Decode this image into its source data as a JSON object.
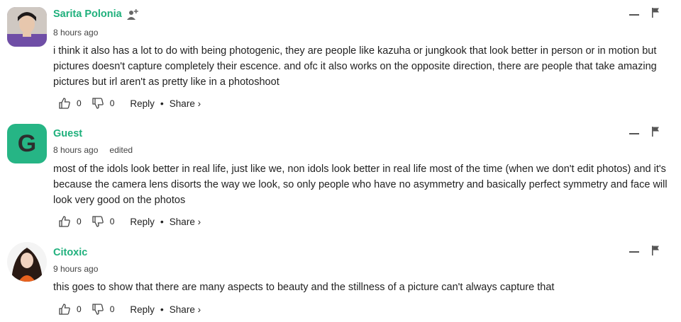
{
  "comments": [
    {
      "author": "Sarita Polonia",
      "time": "8 hours ago",
      "edited": "",
      "text": "i think it also has a lot to do with being photogenic, they are people like kazuha or jungkook that look better in person or in motion but pictures doesn't capture completely their escence. and ofc it also works on the opposite direction, there are people that take amazing pictures but irl aren't as pretty like in a photoshoot",
      "likes": "0",
      "dislikes": "0",
      "reply_label": "Reply",
      "share_label": "Share ›",
      "avatar": "photo"
    },
    {
      "author": "Guest",
      "time": "8 hours ago",
      "edited": "edited",
      "text": "most of the idols look better in real life, just like we, non idols look better in real life most of the time (when we don't edit photos) and it's because the camera lens disorts the way we look, so only people who have no asymmetry and basically perfect symmetry and face will look very good on the photos",
      "likes": "0",
      "dislikes": "0",
      "reply_label": "Reply",
      "share_label": "Share ›",
      "avatar_letter": "G"
    },
    {
      "author": "Citoxic",
      "time": "9 hours ago",
      "edited": "",
      "text": "this goes to show that there are many aspects to beauty and the stillness of a picture can't always capture that",
      "likes": "0",
      "dislikes": "0",
      "reply_label": "Reply",
      "share_label": "Share ›",
      "avatar": "photo"
    }
  ],
  "colors": {
    "accent": "#1fb07c",
    "guest_avatar": "#26b585"
  },
  "icons": [
    "follow-user-icon",
    "minimize-icon",
    "flag-icon",
    "thumbs-up-icon",
    "thumbs-down-icon"
  ]
}
